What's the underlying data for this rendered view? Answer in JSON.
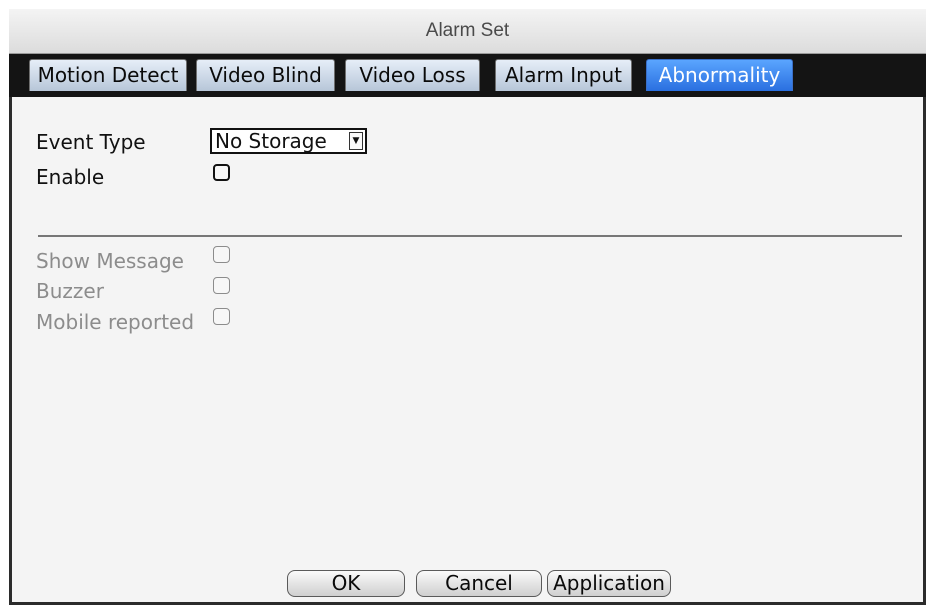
{
  "window": {
    "title": "Alarm Set"
  },
  "tabs": [
    {
      "label": "Motion Detect",
      "active": false
    },
    {
      "label": "Video Blind",
      "active": false
    },
    {
      "label": "Video Loss",
      "active": false
    },
    {
      "label": "Alarm Input",
      "active": false
    },
    {
      "label": "Abnormality",
      "active": true
    }
  ],
  "form": {
    "event_type": {
      "label": "Event Type",
      "selected": "No Storage"
    },
    "enable": {
      "label": "Enable",
      "checked": false
    },
    "show_message": {
      "label": "Show Message",
      "checked": false,
      "enabled": false
    },
    "buzzer": {
      "label": "Buzzer",
      "checked": false,
      "enabled": false
    },
    "mobile_reported": {
      "label": "Mobile reported",
      "checked": false,
      "enabled": false
    }
  },
  "buttons": {
    "ok": "OK",
    "cancel": "Cancel",
    "apply": "Application"
  },
  "colors": {
    "active_tab": "#2a6fe0",
    "inactive_tab": "#b7c6d8",
    "disabled_text": "#8c8c8c"
  },
  "icons": {
    "dropdown": "chevron-down-icon"
  }
}
